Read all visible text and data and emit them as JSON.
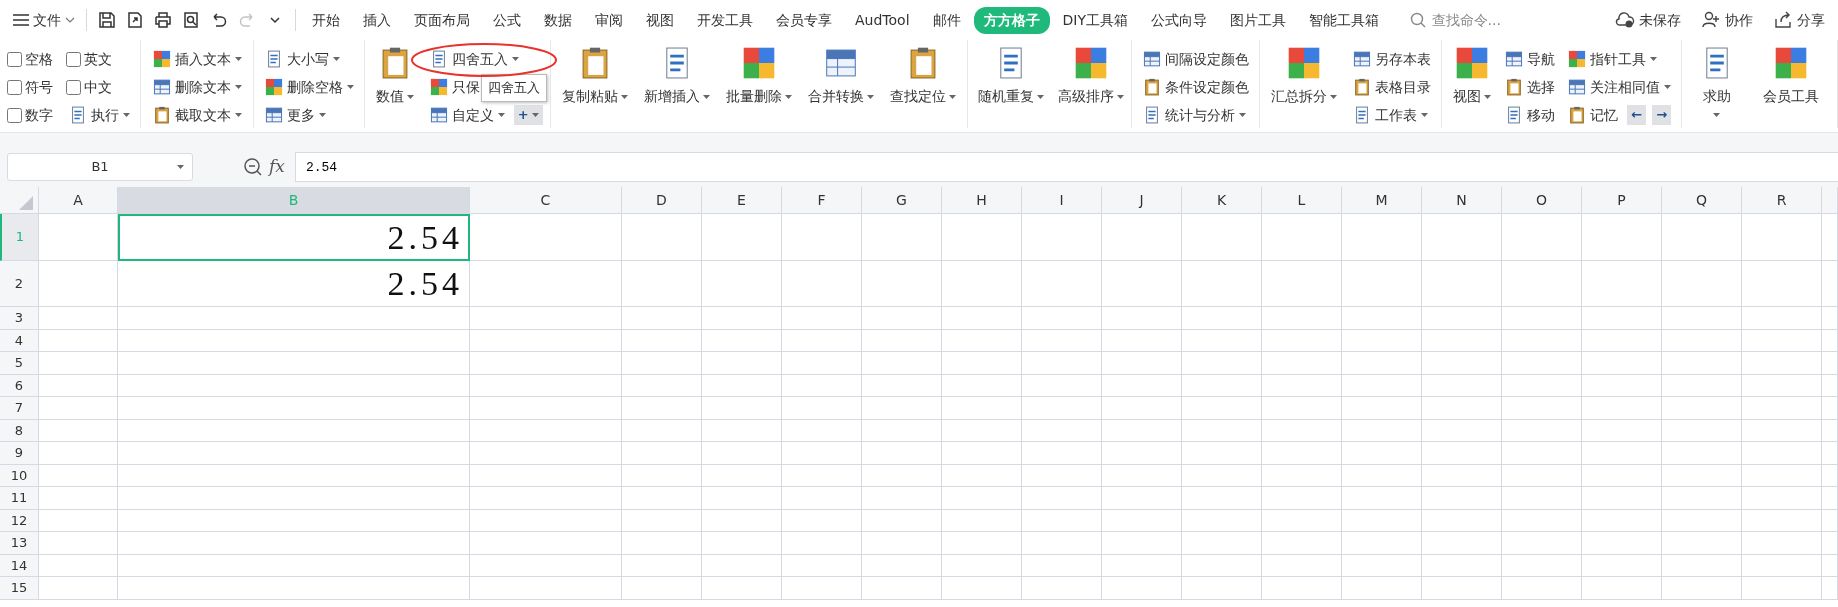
{
  "file_menu": {
    "label": "文件"
  },
  "quick_access": [
    {
      "disabled": false
    },
    {
      "disabled": false
    },
    {
      "disabled": false
    },
    {
      "disabled": false
    },
    {
      "disabled": false
    },
    {
      "disabled": true
    },
    {
      "disabled": false
    }
  ],
  "tabs": [
    {
      "label": "开始",
      "selected": false
    },
    {
      "label": "插入",
      "selected": false
    },
    {
      "label": "页面布局",
      "selected": false
    },
    {
      "label": "公式",
      "selected": false
    },
    {
      "label": "数据",
      "selected": false
    },
    {
      "label": "审阅",
      "selected": false
    },
    {
      "label": "视图",
      "selected": false
    },
    {
      "label": "开发工具",
      "selected": false
    },
    {
      "label": "会员专享",
      "selected": false
    },
    {
      "label": "AudTool",
      "selected": false
    },
    {
      "label": "邮件",
      "selected": false
    },
    {
      "label": "方方格子",
      "selected": true
    },
    {
      "label": "DIY工具箱",
      "selected": false
    },
    {
      "label": "公式向导",
      "selected": false
    },
    {
      "label": "图片工具",
      "selected": false
    },
    {
      "label": "智能工具箱",
      "selected": false
    }
  ],
  "search": {
    "placeholder": "查找命令..."
  },
  "top_actions": [
    {
      "label": "未保存"
    },
    {
      "label": "协作"
    },
    {
      "label": "分享"
    }
  ],
  "ribbon": [
    {
      "columns": [
        {
          "kind": "stack",
          "rows": [
            [
              {
                "kind": "checkbox",
                "label": "空格",
                "checked": false
              }
            ],
            [
              {
                "kind": "checkbox",
                "label": "符号",
                "checked": false
              }
            ],
            [
              {
                "kind": "checkbox",
                "label": "数字",
                "checked": false
              }
            ]
          ]
        },
        {
          "kind": "stack",
          "rows": [
            [
              {
                "kind": "checkbox",
                "label": "英文",
                "checked": false
              }
            ],
            [
              {
                "kind": "checkbox",
                "label": "中文",
                "checked": false
              }
            ],
            [
              {
                "kind": "button",
                "label": "执行",
                "dropdown": true
              }
            ]
          ]
        }
      ]
    },
    {
      "columns": [
        {
          "kind": "stack",
          "rows": [
            [
              {
                "kind": "button",
                "label": "插入文本",
                "dropdown": true
              }
            ],
            [
              {
                "kind": "button",
                "label": "删除文本",
                "dropdown": true
              }
            ],
            [
              {
                "kind": "button",
                "label": "截取文本",
                "dropdown": true
              }
            ]
          ]
        }
      ]
    },
    {
      "columns": [
        {
          "kind": "stack",
          "rows": [
            [
              {
                "kind": "button",
                "label": "大小写",
                "dropdown": true
              }
            ],
            [
              {
                "kind": "button",
                "label": "删除空格",
                "dropdown": true
              }
            ],
            [
              {
                "kind": "button",
                "label": "更多",
                "dropdown": true
              }
            ]
          ]
        }
      ]
    },
    {
      "columns": [
        {
          "kind": "big",
          "label": "数值",
          "dropdown": true
        },
        {
          "kind": "stack",
          "rows": [
            [
              {
                "kind": "button",
                "label": "四舍五入",
                "dropdown": true
              }
            ],
            [
              {
                "kind": "button",
                "label": "只保",
                "dropdown": false
              }
            ],
            [
              {
                "kind": "button",
                "label": "自定义",
                "dropdown": true
              },
              {
                "kind": "glyph",
                "label": "+",
                "dropdown": true
              }
            ]
          ]
        }
      ]
    },
    {
      "columns": [
        {
          "kind": "big",
          "label": "复制粘贴",
          "dropdown": true
        },
        {
          "kind": "big",
          "label": "新增插入",
          "dropdown": true
        },
        {
          "kind": "big",
          "label": "批量删除",
          "dropdown": true
        },
        {
          "kind": "big",
          "label": "合并转换",
          "dropdown": true
        },
        {
          "kind": "big",
          "label": "查找定位",
          "dropdown": true
        }
      ]
    },
    {
      "columns": [
        {
          "kind": "big",
          "label": "随机重复",
          "dropdown": true
        },
        {
          "kind": "big",
          "label": "高级排序",
          "dropdown": true
        }
      ]
    },
    {
      "columns": [
        {
          "kind": "stack",
          "rows": [
            [
              {
                "kind": "button",
                "label": "间隔设定颜色",
                "dropdown": false
              }
            ],
            [
              {
                "kind": "button",
                "label": "条件设定颜色",
                "dropdown": false
              }
            ],
            [
              {
                "kind": "button",
                "label": "统计与分析",
                "dropdown": true
              }
            ]
          ]
        }
      ]
    },
    {
      "columns": [
        {
          "kind": "big",
          "label": "汇总拆分",
          "dropdown": true
        },
        {
          "kind": "stack",
          "rows": [
            [
              {
                "kind": "button",
                "label": "另存本表",
                "dropdown": false
              }
            ],
            [
              {
                "kind": "button",
                "label": "表格目录",
                "dropdown": false
              }
            ],
            [
              {
                "kind": "button",
                "label": "工作表",
                "dropdown": true
              }
            ]
          ]
        }
      ]
    },
    {
      "columns": [
        {
          "kind": "big",
          "label": "视图",
          "dropdown": true
        },
        {
          "kind": "stack",
          "rows": [
            [
              {
                "kind": "button",
                "label": "导航",
                "dropdown": false
              }
            ],
            [
              {
                "kind": "button",
                "label": "选择",
                "dropdown": false
              }
            ],
            [
              {
                "kind": "button",
                "label": "移动",
                "dropdown": false
              }
            ]
          ]
        },
        {
          "kind": "stack",
          "rows": [
            [
              {
                "kind": "button",
                "label": "指针工具",
                "dropdown": true
              }
            ],
            [
              {
                "kind": "button",
                "label": "关注相同值",
                "dropdown": true
              }
            ],
            [
              {
                "kind": "button",
                "label": "记忆",
                "dropdown": false
              },
              {
                "kind": "glyph",
                "label": "←",
                "dropdown": false
              },
              {
                "kind": "glyph",
                "label": "→",
                "dropdown": false
              }
            ]
          ]
        }
      ]
    },
    {
      "columns": [
        {
          "kind": "big_menu",
          "label": "求助",
          "dropdown": true
        },
        {
          "kind": "big",
          "label": "会员工具",
          "dropdown": false
        }
      ]
    }
  ],
  "tooltip": {
    "text": "四舍五入"
  },
  "formula_bar": {
    "name_box": "B1",
    "fx_label": "fx",
    "formula": "2.54"
  },
  "sheet": {
    "columns": [
      {
        "label": "A",
        "selected": false
      },
      {
        "label": "B",
        "selected": true,
        "cells": [
          {
            "value": "2.54",
            "selected": true
          },
          {
            "value": "2.54",
            "selected": false
          }
        ]
      },
      {
        "label": "C",
        "selected": false
      },
      {
        "label": "D",
        "selected": false
      },
      {
        "label": "E",
        "selected": false
      },
      {
        "label": "F",
        "selected": false
      },
      {
        "label": "G",
        "selected": false
      },
      {
        "label": "H",
        "selected": false
      },
      {
        "label": "I",
        "selected": false
      },
      {
        "label": "J",
        "selected": false
      },
      {
        "label": "K",
        "selected": false
      },
      {
        "label": "L",
        "selected": false
      },
      {
        "label": "M",
        "selected": false
      },
      {
        "label": "N",
        "selected": false
      },
      {
        "label": "O",
        "selected": false
      },
      {
        "label": "P",
        "selected": false
      },
      {
        "label": "Q",
        "selected": false
      },
      {
        "label": "R",
        "selected": false
      }
    ],
    "rows": [
      {
        "label": "1",
        "selected": true
      },
      {
        "label": "2",
        "selected": false
      },
      {
        "label": "3",
        "selected": false
      },
      {
        "label": "4",
        "selected": false
      },
      {
        "label": "5",
        "selected": false
      },
      {
        "label": "6",
        "selected": false
      },
      {
        "label": "7",
        "selected": false
      },
      {
        "label": "8",
        "selected": false
      },
      {
        "label": "9",
        "selected": false
      },
      {
        "label": "10",
        "selected": false
      },
      {
        "label": "11",
        "selected": false
      },
      {
        "label": "12",
        "selected": false
      },
      {
        "label": "13",
        "selected": false
      },
      {
        "label": "14",
        "selected": false
      },
      {
        "label": "15",
        "selected": false
      }
    ]
  }
}
